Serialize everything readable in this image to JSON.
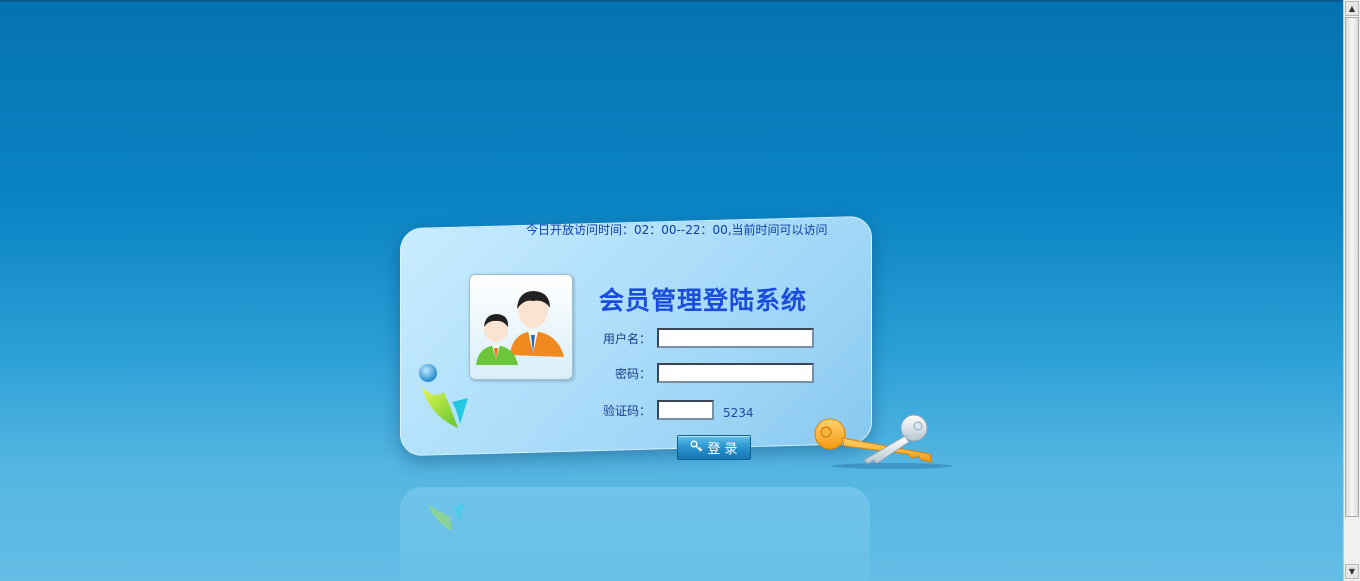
{
  "notice": "今日开放访问时间：02：00--22：00,当前时间可以访问",
  "title": "会员管理登陆系统",
  "form": {
    "username_label": "用户名：",
    "password_label": "密码：",
    "captcha_label": "验证码：",
    "username_value": "",
    "password_value": "",
    "captcha_input_value": "",
    "captcha_code": "5234"
  },
  "login_button": "登 录",
  "icons": {
    "avatar": "users-avatar-icon",
    "logo": "brand-logo-icon",
    "keys": "keys-icon",
    "button": "key-icon"
  },
  "colors": {
    "background_top": "#0472b1",
    "background_bottom": "#64bde5",
    "card": "#b3e1fb",
    "title": "#1a4ddc",
    "label": "#1b3c8a",
    "button": "#2a93cd"
  }
}
